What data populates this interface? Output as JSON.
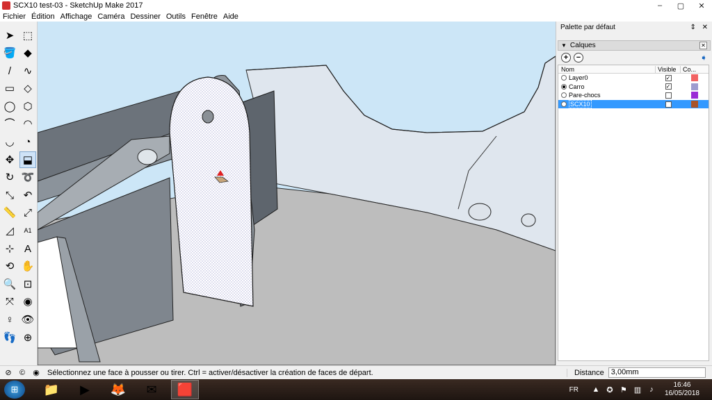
{
  "window": {
    "title": "SCX10 test-03 - SketchUp Make 2017",
    "min_label": "–",
    "max_label": "▢",
    "close_label": "✕"
  },
  "menu": [
    {
      "name": "menu-fichier",
      "label": "Fichier"
    },
    {
      "name": "menu-edition",
      "label": "Édition"
    },
    {
      "name": "menu-affichage",
      "label": "Affichage"
    },
    {
      "name": "menu-camera",
      "label": "Caméra"
    },
    {
      "name": "menu-dessiner",
      "label": "Dessiner"
    },
    {
      "name": "menu-outils",
      "label": "Outils"
    },
    {
      "name": "menu-fenetre",
      "label": "Fenêtre"
    },
    {
      "name": "menu-aide",
      "label": "Aide"
    }
  ],
  "tools": [
    {
      "name": "select-icon",
      "glyph": "➤"
    },
    {
      "name": "make-component-icon",
      "glyph": "⬚"
    },
    {
      "name": "paint-bucket-icon",
      "glyph": "🪣"
    },
    {
      "name": "eraser-icon",
      "glyph": "◆"
    },
    {
      "name": "line-icon",
      "glyph": "/"
    },
    {
      "name": "freehand-icon",
      "glyph": "∿"
    },
    {
      "name": "rectangle-icon",
      "glyph": "▭"
    },
    {
      "name": "rotated-rectangle-icon",
      "glyph": "◇"
    },
    {
      "name": "circle-icon",
      "glyph": "◯"
    },
    {
      "name": "polygon-icon",
      "glyph": "⬡"
    },
    {
      "name": "arc-icon",
      "glyph": "⌒"
    },
    {
      "name": "two-point-arc-icon",
      "glyph": "◠"
    },
    {
      "name": "three-point-arc-icon",
      "glyph": "◡"
    },
    {
      "name": "pie-icon",
      "glyph": "◔"
    },
    {
      "name": "move-icon",
      "glyph": "✥"
    },
    {
      "name": "push-pull-icon",
      "glyph": "⬓"
    },
    {
      "name": "rotate-icon",
      "glyph": "↻"
    },
    {
      "name": "follow-me-icon",
      "glyph": "➰"
    },
    {
      "name": "scale-icon",
      "glyph": "⤡"
    },
    {
      "name": "offset-icon",
      "glyph": "↶"
    },
    {
      "name": "tape-measure-icon",
      "glyph": "📏"
    },
    {
      "name": "dimension-icon",
      "glyph": "⤢"
    },
    {
      "name": "protractor-icon",
      "glyph": "◿"
    },
    {
      "name": "text-icon",
      "glyph": "A1"
    },
    {
      "name": "axes-icon",
      "glyph": "⊹"
    },
    {
      "name": "3d-text-icon",
      "glyph": "A"
    },
    {
      "name": "orbit-icon",
      "glyph": "⟲"
    },
    {
      "name": "pan-icon",
      "glyph": "✋"
    },
    {
      "name": "zoom-icon",
      "glyph": "🔍"
    },
    {
      "name": "zoom-window-icon",
      "glyph": "⊡"
    },
    {
      "name": "zoom-extents-icon",
      "glyph": "⤧"
    },
    {
      "name": "previous-view-icon",
      "glyph": "◉"
    },
    {
      "name": "position-camera-icon",
      "glyph": "♀"
    },
    {
      "name": "look-around-icon",
      "glyph": "👁"
    },
    {
      "name": "walk-icon",
      "glyph": "👣"
    },
    {
      "name": "section-plane-icon",
      "glyph": "⊕"
    }
  ],
  "active_tool": "push-pull-icon",
  "tray": {
    "title": "Palette par défaut",
    "pin_label": "⇕",
    "close_label": "✕"
  },
  "layers_panel": {
    "title": "Calques",
    "collapse_glyph": "▼",
    "close_glyph": "✕",
    "add_glyph": "+",
    "remove_glyph": "−",
    "details_glyph": "➧",
    "columns": {
      "name": "Nom",
      "visible": "Visible",
      "color": "Co..."
    },
    "rows": [
      {
        "name": "Layer0",
        "active": false,
        "visible": true,
        "color": "#f26363",
        "selected": false
      },
      {
        "name": "Carro",
        "active": true,
        "visible": true,
        "color": "#9e9ccf",
        "selected": false
      },
      {
        "name": "Pare-chocs",
        "active": false,
        "visible": false,
        "color": "#9a2bd6",
        "selected": false
      },
      {
        "name": "SCX10",
        "active": false,
        "visible": false,
        "color": "#a8532a",
        "selected": true
      }
    ]
  },
  "status": {
    "message": "Sélectionnez une face à pousser ou tirer.  Ctrl = activer/désactiver la création de faces de départ.",
    "measure_label": "Distance",
    "measure_value": "3,00mm"
  },
  "taskbar": {
    "start_glyph": "⊞",
    "apps": [
      {
        "name": "explorer-icon",
        "glyph": "📁",
        "active": false
      },
      {
        "name": "media-player-icon",
        "glyph": "▶",
        "active": false
      },
      {
        "name": "firefox-icon",
        "glyph": "🦊",
        "active": false
      },
      {
        "name": "thunderbird-icon",
        "glyph": "✉",
        "active": false
      },
      {
        "name": "sketchup-icon",
        "glyph": "🟥",
        "active": true
      }
    ],
    "language": "FR",
    "time": "16:46",
    "date": "16/05/2018"
  }
}
